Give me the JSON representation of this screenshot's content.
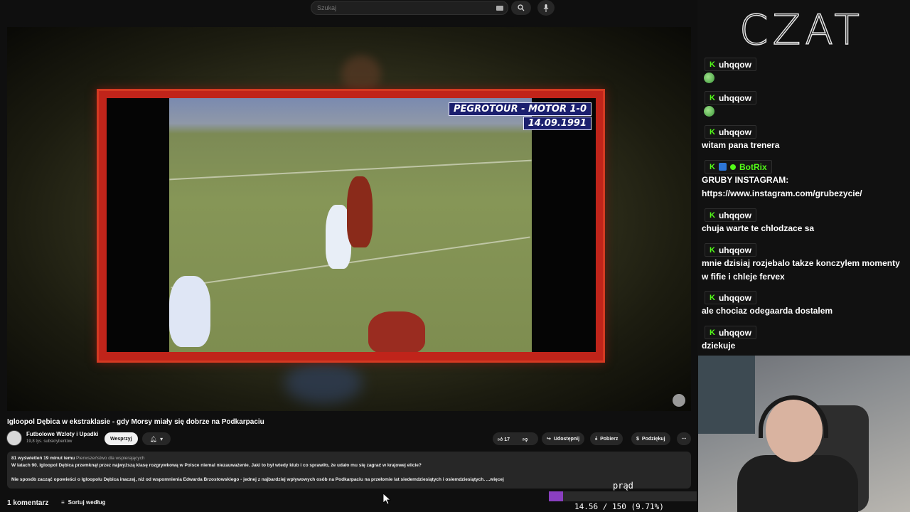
{
  "search": {
    "placeholder": "Szukaj"
  },
  "video": {
    "overlay_line1": "PEGROTOUR - MOTOR 1-0",
    "overlay_line2": "14.09.1991",
    "title": "Igloopol Dębica w ekstraklasie - gdy Morsy miały się dobrze na Podkarpaciu"
  },
  "channel": {
    "name": "Futbolowe Wzloty i Upadki",
    "subscribers": "19,8 tys. subskrybentów",
    "support_label": "Wesprzyj"
  },
  "actions": {
    "likes": "17",
    "share": "Udostępnij",
    "download": "Pobierz",
    "thanks": "Podziękuj"
  },
  "description": {
    "meta": "81 wyświetleń  19 minut temu",
    "premiere": "Pierwszeństwo dla wspierających",
    "line1": "W latach 90. Igloopol Dębica przemknął przez najwyższą klasę rozgrywkową w Polsce niemal niezauważenie. Jaki to był wtedy klub i co sprawiło, że udało mu się zagrać w krajowej elicie?",
    "line2": "Nie sposób zacząć opowieści o Igloopolu Dębica inaczej, niż od wspomnienia Edwarda Brzostowskiego - jednej z najbardziej wpływowych osób na Podkarpaciu na przełomie lat siedemdziesiątych i osiemdziesiątych.",
    "more": "...więcej"
  },
  "comments": {
    "count_label": "1 komentarz",
    "sort_label": "Sortuj według"
  },
  "chat": {
    "header": "CZAT",
    "messages": [
      {
        "user": "uhqqow",
        "text": ""
      },
      {
        "user": "uhqqow",
        "text": ""
      },
      {
        "user": "uhqqow",
        "text": "witam pana trenera"
      },
      {
        "user": "BotRix",
        "text": "GRUBY INSTAGRAM: https://www.instagram.com/grubezycie/"
      },
      {
        "user": "uhqqow",
        "text": "chuja warte te chlodzace sa"
      },
      {
        "user": "uhqqow",
        "text": "mnie dzisiaj rozjebalo takze konczylem momenty w fifie i chleje fervex"
      },
      {
        "user": "uhqqow",
        "text": "ale chociaz odegaarda dostalem"
      },
      {
        "user": "uhqqow",
        "text": "dziekuje"
      }
    ]
  },
  "power": {
    "label": "prąd",
    "readout": "14.56 / 150 (9.71%)",
    "fraction": 0.0971
  }
}
